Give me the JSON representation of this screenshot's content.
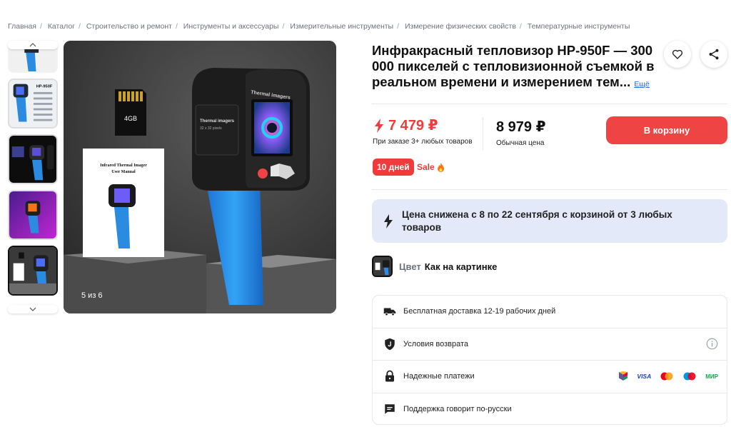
{
  "breadcrumb": [
    "Главная",
    "Каталог",
    "Строительство и ремонт",
    "Инструменты и аксессуары",
    "Измерительные инструменты",
    "Измерение физических свойств",
    "Температурные инструменты"
  ],
  "product": {
    "title": "Инфракрасный тепловизор HP-950F — 300 000 пикселей с тепловизионной съемкой в реальном времени и измерением тем...",
    "more_link": "Ещё"
  },
  "gallery": {
    "counter": "5 из 6",
    "active_index": 5,
    "image_texts": {
      "card": "4GB",
      "manual_title_1": "Infrared Thermal Imager",
      "manual_title_2": "User Manual",
      "device_label": "Thermal imagers",
      "screen_label_1": "Thermal imagers",
      "screen_label_2": "32 x 32 pixels",
      "thumb_model": "HP-950F"
    }
  },
  "price": {
    "sale_price": "7 479 ₽",
    "sale_note": "При заказе 3+ любых товаров",
    "regular_price": "8 979 ₽",
    "regular_note": "Обычная цена"
  },
  "cart_button": "В корзину",
  "badges": {
    "days": "10 дней",
    "sale": "Sale"
  },
  "promo": {
    "text": "Цена снижена с 8 по 22 сентября с корзиной от 3 любых товаров"
  },
  "color": {
    "label": "Цвет",
    "value": "Как на картинке"
  },
  "info": [
    {
      "icon": "truck-icon",
      "text": "Бесплатная доставка 12-19 рабочих дней"
    },
    {
      "icon": "shield-icon",
      "text": "Условия возврата"
    },
    {
      "icon": "lock-icon",
      "text": "Надежные платежи"
    },
    {
      "icon": "chat-icon",
      "text": "Поддержка говорит по-русски"
    }
  ],
  "payments": {
    "visa": "VISA",
    "mir": "МИР"
  },
  "colors": {
    "accent_red": "#ef3b3b",
    "promo_bg": "#e3e9f9",
    "link_blue": "#2563eb"
  }
}
